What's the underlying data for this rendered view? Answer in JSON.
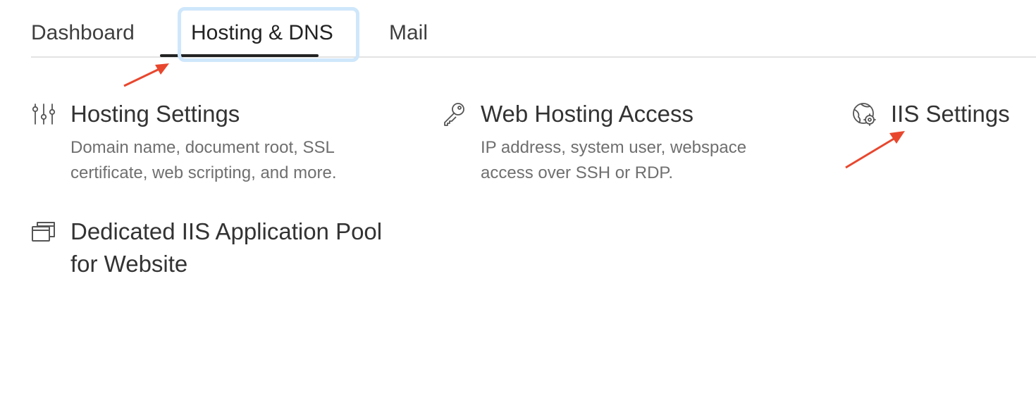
{
  "tabs": {
    "dashboard": "Dashboard",
    "hosting": "Hosting & DNS",
    "mail": "Mail",
    "active": "hosting"
  },
  "cards": {
    "hosting_settings": {
      "title": "Hosting Settings",
      "desc_line1": "Domain name, document root, SSL",
      "desc_line2": "certificate, web scripting, and more.",
      "icon": "sliders-icon"
    },
    "web_hosting_access": {
      "title": "Web Hosting Access",
      "desc_line1": "IP address, system user, webspace",
      "desc_line2": "access over SSH or RDP.",
      "icon": "key-icon"
    },
    "iis_settings": {
      "title": "IIS Settings",
      "icon": "globe-gear-icon"
    },
    "app_pool": {
      "title": "Dedicated IIS Application Pool for Website",
      "icon": "windows-stack-icon"
    }
  },
  "colors": {
    "annotation_arrow": "#e8472e",
    "focus_ring": "#cfe7fb",
    "active_underline": "#222222",
    "divider": "#e3e3e3"
  }
}
